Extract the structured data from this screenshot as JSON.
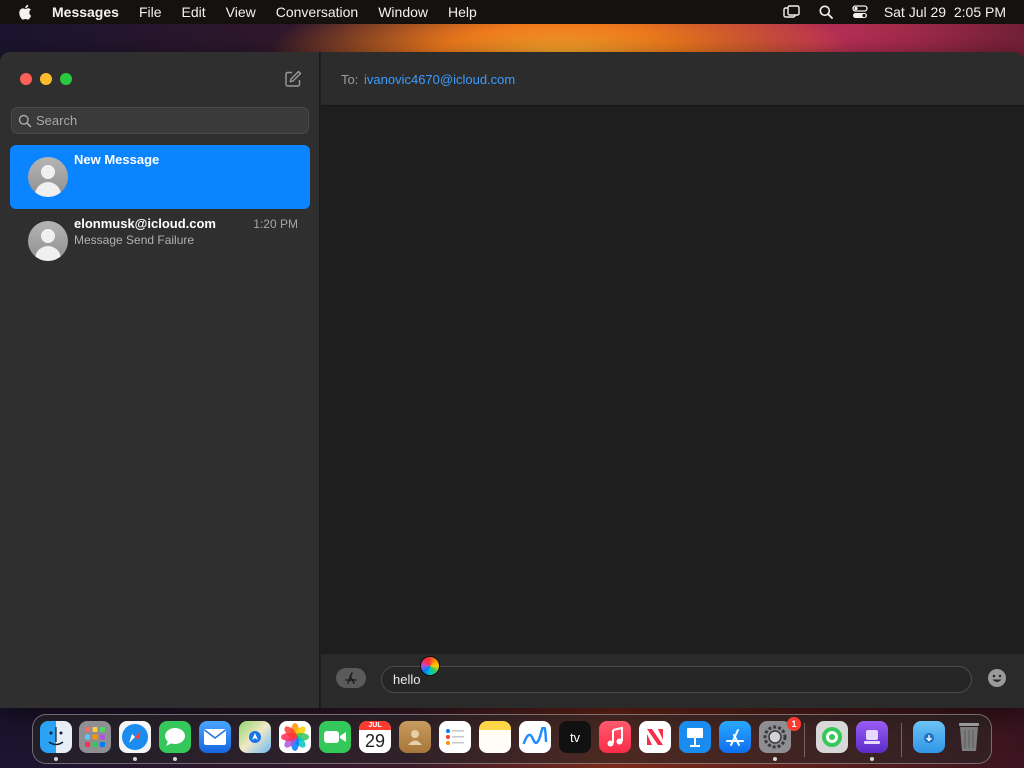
{
  "menubar": {
    "app_name": "Messages",
    "items": [
      "File",
      "Edit",
      "View",
      "Conversation",
      "Window",
      "Help"
    ],
    "datetime": "Sat Jul 29  2:05 PM"
  },
  "sidebar": {
    "search_placeholder": "Search",
    "conversations": [
      {
        "name": "New Message",
        "preview": "",
        "time": "",
        "selected": true
      },
      {
        "name": "elonmusk@icloud.com",
        "preview": "Message Send Failure",
        "time": "1:20 PM",
        "selected": false
      }
    ]
  },
  "main": {
    "to_label": "To:",
    "recipient": "ivanovic4670@icloud.com",
    "message_text": "hello"
  },
  "dock": {
    "calendar_month": "JUL",
    "calendar_day": "29",
    "tv_label": "tv",
    "settings_badge": "1",
    "apps": [
      "Finder",
      "Launchpad",
      "Safari",
      "Messages",
      "Mail",
      "Maps",
      "Photos",
      "FaceTime",
      "Calendar",
      "Contacts",
      "Reminders",
      "Notes",
      "Freeform",
      "TV",
      "Music",
      "News",
      "Keynote",
      "App Store",
      "System Settings",
      "Find My",
      "Creator",
      "Downloads",
      "Trash"
    ]
  },
  "colors": {
    "accent": "#0a84ff",
    "link": "#3b9cff",
    "sidebar_bg": "#2f2f2f",
    "window_bg": "#1e1e1e"
  }
}
